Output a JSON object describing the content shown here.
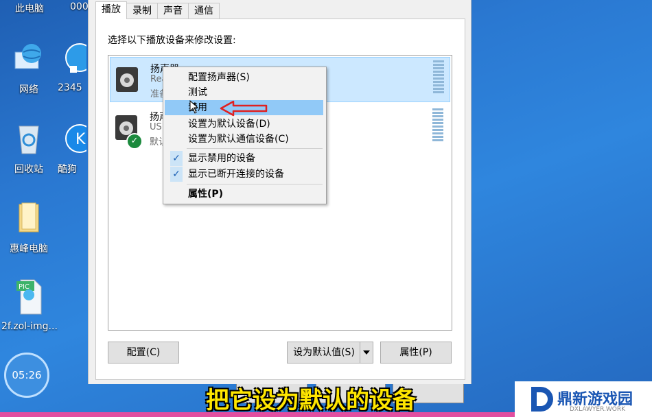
{
  "desktop": {
    "top_texts": [
      "此电脑",
      "000"
    ],
    "icons": [
      {
        "label": "网络",
        "icon": "network-globe-icon"
      },
      {
        "label": "2345",
        "icon": "browser-shortcut-icon"
      },
      {
        "label": "回收站",
        "icon": "recycle-bin-icon"
      },
      {
        "label": "酷狗",
        "icon": "kugou-music-icon"
      },
      {
        "label": "惠峰电脑",
        "icon": "folder-icon"
      },
      {
        "label": "2f.zol-img...",
        "icon": "pic-file-icon"
      }
    ],
    "clock": "05:26"
  },
  "dialog": {
    "tabs": [
      "播放",
      "录制",
      "声音",
      "通信"
    ],
    "instruction": "选择以下播放设备来修改设置:",
    "devices": [
      {
        "name": "扬声器",
        "sub": "Rea",
        "status": "准备",
        "icon": "speaker-icon"
      },
      {
        "name": "扬声",
        "sub": "US",
        "status": "默认",
        "icon": "speaker-icon"
      }
    ],
    "buttons": {
      "configure": "配置(C)",
      "set_default": "设为默认值(S)",
      "properties": "属性(P)"
    }
  },
  "context_menu": {
    "items": [
      "配置扬声器(S)",
      "测试",
      "禁用",
      "设置为默认设备(D)",
      "设置为默认通信设备(C)"
    ],
    "checked_items": [
      "显示禁用的设备",
      "显示已断开连接的设备"
    ],
    "properties": "属性(P)",
    "check_glyph": "✓"
  },
  "overlay": {
    "caption": "把它设为默认的设备",
    "logo_title": "鼎新游戏园",
    "logo_sub": "DXLAWYER.WORK"
  },
  "colors": {
    "desktop": "#2a78d1",
    "selection": "#cce8ff",
    "menu_hover": "#91c9f7",
    "arrow": "#e02020",
    "caption": "#ffe600"
  }
}
